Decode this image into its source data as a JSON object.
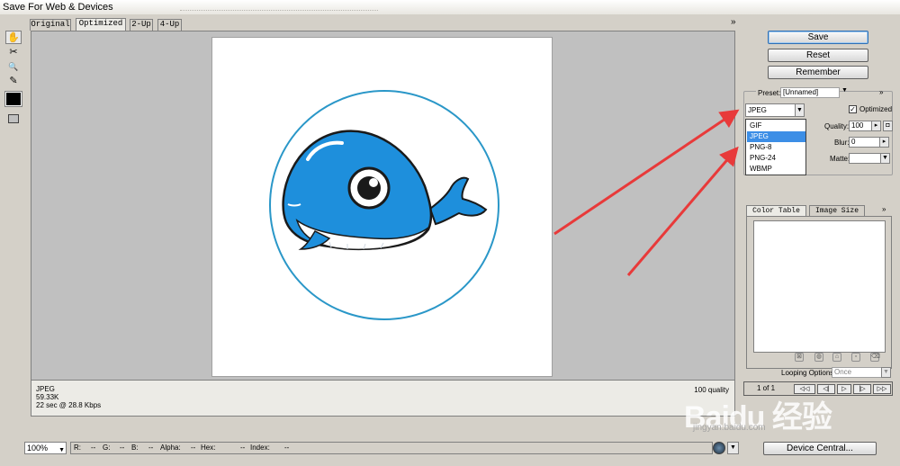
{
  "window": {
    "title": "Save For Web & Devices"
  },
  "tabs": [
    {
      "label": "Original"
    },
    {
      "label": "Optimized",
      "active": true
    },
    {
      "label": "2-Up"
    },
    {
      "label": "4-Up"
    }
  ],
  "tabs_menu_glyph": "»",
  "tools": [
    {
      "name": "hand-tool-icon",
      "glyph": "✋",
      "active": true
    },
    {
      "name": "slice-select-tool-icon",
      "glyph": "✂"
    },
    {
      "name": "zoom-tool-icon",
      "glyph": "🔍"
    },
    {
      "name": "eyedropper-tool-icon",
      "glyph": "✎"
    }
  ],
  "eyedropper_color": "#000000",
  "preview": {
    "format": "JPEG",
    "size": "59.33K",
    "download_time": "22 sec @ 28.8 Kbps",
    "quality_note": "100 quality"
  },
  "status": {
    "zoom": "100%",
    "readouts": [
      "R:",
      "--",
      "G:",
      "--",
      "B:",
      "--",
      "Alpha:",
      "--",
      "Hex:",
      "--",
      "Index:",
      "--"
    ]
  },
  "buttons": {
    "save": "Save",
    "reset": "Reset",
    "remember": "Remember",
    "device_central": "Device Central..."
  },
  "settings": {
    "preset_label": "Preset:",
    "preset_value": "[Unnamed]",
    "format_value": "JPEG",
    "optimized_label": "Optimized",
    "optimized_checked": true,
    "quality_label": "Quality:",
    "quality_value": "100",
    "blur_label": "Blur:",
    "blur_value": "0",
    "matte_label": "Matte:"
  },
  "format_options": [
    {
      "label": "GIF"
    },
    {
      "label": "JPEG",
      "selected": true
    },
    {
      "label": "PNG-8"
    },
    {
      "label": "PNG-24"
    },
    {
      "label": "WBMP"
    }
  ],
  "panel_tabs": [
    {
      "label": "Color Table",
      "active": true
    },
    {
      "label": "Image Size"
    }
  ],
  "animation": {
    "looping_label": "Looping Options:",
    "looping_value": "Once",
    "frame_counter": "1 of 1"
  },
  "watermark": {
    "text": "Baidu 经验",
    "url": "jingyan.baidu.com"
  },
  "colors": {
    "whale_blue": "#1e8fdc",
    "ring_blue": "#2a97c8",
    "annotation_red": "#e83a3a",
    "selection_blue": "#3c8ee6"
  }
}
